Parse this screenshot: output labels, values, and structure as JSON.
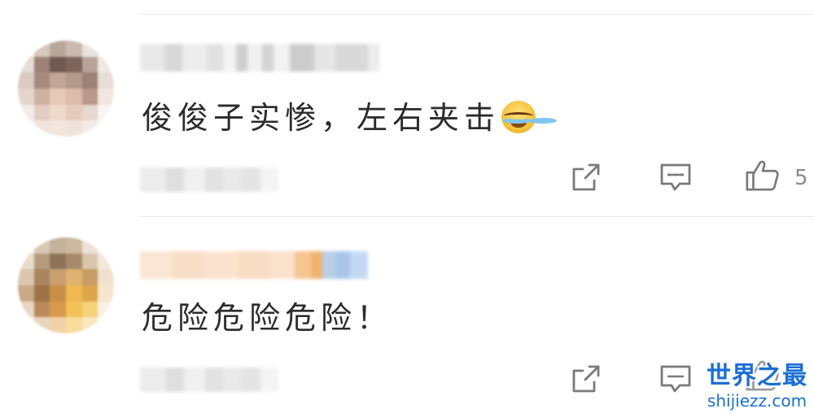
{
  "comments": [
    {
      "text": "俊俊子实惨，左右夹击",
      "emoji": "laughing-crying-emoji",
      "like_count": "5"
    },
    {
      "text": "危险危险危险！",
      "like_count": ""
    }
  ],
  "watermark": {
    "title": "世界之最",
    "url": "shijiezz.com"
  },
  "colors": {
    "text": "#2b2b2b",
    "icon": "#7a7a7a",
    "divider": "#ececec",
    "watermark": "#1a6fd8"
  }
}
